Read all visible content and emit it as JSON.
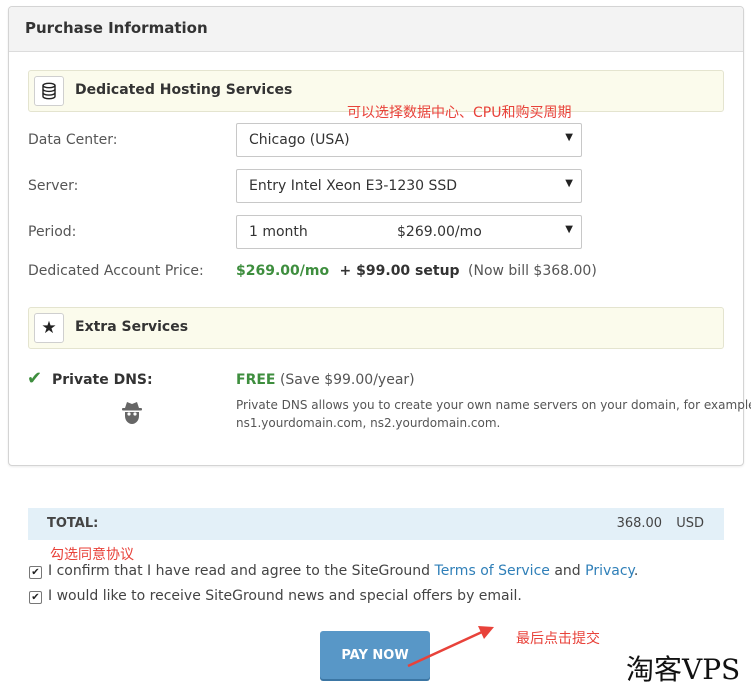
{
  "panel": {
    "title": "Purchase Information"
  },
  "dedicated": {
    "section_label": "Dedicated Hosting Services",
    "icon": "database-icon",
    "annotation": "可以选择数据中心、CPU和购买周期",
    "data_center": {
      "label": "Data Center:",
      "value": "Chicago (USA)"
    },
    "server": {
      "label": "Server:",
      "value": "Entry Intel Xeon E3-1230 SSD"
    },
    "period": {
      "label": "Period:",
      "value": "1 month",
      "price": "$269.00/mo"
    },
    "account_price": {
      "label": "Dedicated Account Price:",
      "price": "$269.00/mo",
      "setup": "+ $99.00 setup",
      "bill": "(Now bill $368.00)"
    }
  },
  "extra": {
    "section_label": "Extra Services",
    "icon": "star-icon",
    "private_dns": {
      "label": "Private DNS:",
      "free": "FREE",
      "save": "(Save $99.00/year)",
      "description_line1": "Private DNS allows you to create your own name servers on your domain, for example:",
      "description_line2": "ns1.yourdomain.com, ns2.yourdomain.com."
    }
  },
  "total": {
    "label": "TOTAL:",
    "amount": "368.00",
    "currency": "USD"
  },
  "agree_annotation": "勾选同意协议",
  "confirm": {
    "checked": true,
    "text_before": "I confirm that I have read and agree to the SiteGround ",
    "terms_link": "Terms of Service",
    "and_text": " and ",
    "privacy_link": "Privacy",
    "period": "."
  },
  "newsletter": {
    "checked": true,
    "text": "I would like to receive SiteGround news and special offers by email."
  },
  "pay_button": "PAY NOW",
  "submit_annotation": "最后点击提交",
  "watermark": "淘客VPS",
  "colors": {
    "accent_green": "#3e8e3e",
    "link_blue": "#2f7fb8",
    "button_blue": "#5897c7",
    "annotation_red": "#e8423a",
    "total_bar": "#e3f0f8"
  }
}
